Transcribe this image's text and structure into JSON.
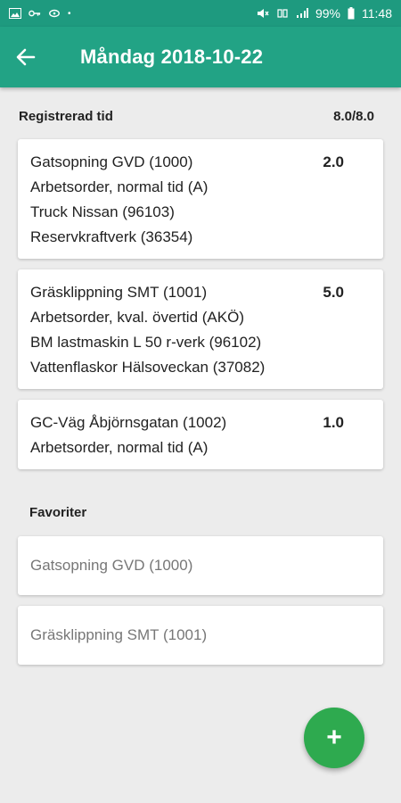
{
  "status_bar": {
    "battery": "99%",
    "time": "11:48"
  },
  "app_bar": {
    "title": "Måndag 2018-10-22"
  },
  "registered": {
    "label": "Registrerad tid",
    "total": "8.0/8.0",
    "entries": [
      {
        "lines": [
          "Gatsopning GVD (1000)",
          "Arbetsorder, normal tid (A)",
          "Truck Nissan (96103)",
          "Reservkraftverk (36354)"
        ],
        "hours": "2.0"
      },
      {
        "lines": [
          "Gräsklippning SMT (1001)",
          "Arbetsorder, kval. övertid (AKÖ)",
          "BM lastmaskin L 50 r-verk (96102)",
          "Vattenflaskor Hälsoveckan (37082)"
        ],
        "hours": "5.0"
      },
      {
        "lines": [
          "GC-Väg Åbjörnsgatan (1002)",
          "Arbetsorder, normal tid (A)"
        ],
        "hours": "1.0"
      }
    ]
  },
  "favorites": {
    "label": "Favoriter",
    "items": [
      "Gatsopning GVD (1000)",
      "Gräsklippning SMT (1001)"
    ]
  },
  "fab": {
    "label": "+"
  },
  "colors": {
    "primary": "#22a385",
    "status_bar": "#1e9a7f",
    "fab": "#2eaa4f",
    "background": "#ececec"
  }
}
